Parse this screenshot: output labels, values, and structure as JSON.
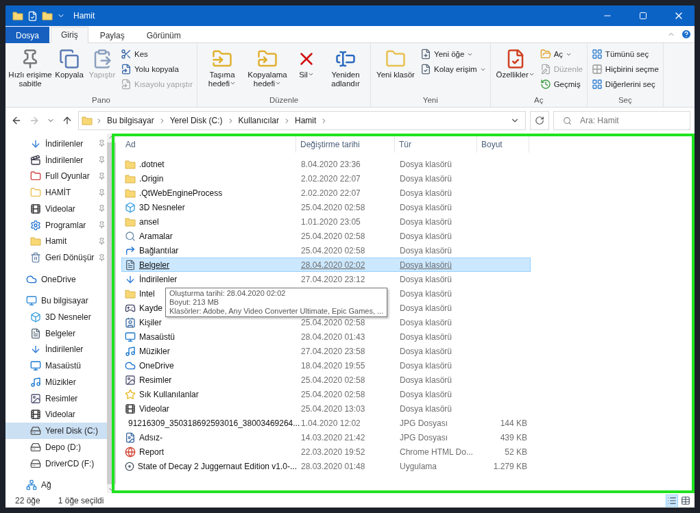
{
  "window": {
    "title": "Hamit"
  },
  "ribbon_tabs": [
    {
      "label": "Dosya",
      "kind": "file",
      "selected": false
    },
    {
      "label": "Giriş",
      "kind": "tab",
      "selected": true
    },
    {
      "label": "Paylaş",
      "kind": "tab",
      "selected": false
    },
    {
      "label": "Görünüm",
      "kind": "tab",
      "selected": false
    }
  ],
  "ribbon_groups": [
    {
      "label": "Pano",
      "items": [
        {
          "kind": "large",
          "label": "Hızlı erişime sabitle",
          "disabled": false,
          "dropdown": false
        },
        {
          "kind": "large",
          "label": "Kopyala",
          "disabled": false,
          "dropdown": false
        },
        {
          "kind": "large",
          "label": "Yapıştır",
          "disabled": true,
          "dropdown": false
        },
        {
          "kind": "small",
          "label": "Kes",
          "disabled": false,
          "dropdown": false
        },
        {
          "kind": "small",
          "label": "Yolu kopyala",
          "disabled": false,
          "dropdown": false
        },
        {
          "kind": "small",
          "label": "Kısayolu yapıştır",
          "disabled": true,
          "dropdown": false
        }
      ]
    },
    {
      "label": "Düzenle",
      "items": [
        {
          "kind": "large",
          "label": "Taşıma hedefi",
          "disabled": false,
          "dropdown": true
        },
        {
          "kind": "large",
          "label": "Kopyalama hedefi",
          "disabled": false,
          "dropdown": true
        },
        {
          "kind": "large",
          "label": "Sil",
          "disabled": false,
          "dropdown": true
        },
        {
          "kind": "large",
          "label": "Yeniden adlandır",
          "disabled": false,
          "dropdown": false
        }
      ]
    },
    {
      "label": "Yeni",
      "items": [
        {
          "kind": "large",
          "label": "Yeni klasör",
          "disabled": false,
          "dropdown": false
        },
        {
          "kind": "small",
          "label": "Yeni öğe",
          "disabled": false,
          "dropdown": true
        },
        {
          "kind": "small",
          "label": "Kolay erişim",
          "disabled": false,
          "dropdown": true
        }
      ]
    },
    {
      "label": "Aç",
      "items": [
        {
          "kind": "large",
          "label": "Özellikler",
          "disabled": false,
          "dropdown": true
        },
        {
          "kind": "small",
          "label": "Aç",
          "disabled": false,
          "dropdown": true
        },
        {
          "kind": "small",
          "label": "Düzenle",
          "disabled": true,
          "dropdown": false
        },
        {
          "kind": "small",
          "label": "Geçmiş",
          "disabled": false,
          "dropdown": false
        }
      ]
    },
    {
      "label": "Seç",
      "items": [
        {
          "kind": "small",
          "label": "Tümünü seç",
          "disabled": false,
          "dropdown": false
        },
        {
          "kind": "small",
          "label": "Hiçbirini seçme",
          "disabled": false,
          "dropdown": false
        },
        {
          "kind": "small",
          "label": "Diğerlerini seç",
          "disabled": false,
          "dropdown": false
        }
      ]
    }
  ],
  "address": {
    "crumbs": [
      "Bu bilgisayar",
      "Yerel Disk (C:)",
      "Kullanıcılar",
      "Hamit"
    ],
    "search_placeholder": "Ara: Hamit"
  },
  "nav": {
    "quick_access": [
      {
        "label": "İndirilenler",
        "pinned": true,
        "selected": false
      },
      {
        "label": "İndirilenler",
        "pinned": true,
        "selected": false
      },
      {
        "label": "Full Oyunlar",
        "pinned": true,
        "selected": false
      },
      {
        "label": "HAMİT",
        "pinned": true,
        "selected": false
      },
      {
        "label": "Videolar",
        "pinned": true,
        "selected": false
      },
      {
        "label": "Programlar",
        "pinned": true,
        "selected": false
      },
      {
        "label": "Hamit",
        "pinned": true,
        "selected": false
      },
      {
        "label": "Geri Dönüşür",
        "pinned": true,
        "selected": false
      }
    ],
    "tree": [
      {
        "label": "OneDrive",
        "selected": false
      },
      {
        "label": "Bu bilgisayar",
        "selected": false,
        "children": [
          {
            "label": "3D Nesneler",
            "selected": false
          },
          {
            "label": "Belgeler",
            "selected": false
          },
          {
            "label": "İndirilenler",
            "selected": false
          },
          {
            "label": "Masaüstü",
            "selected": false
          },
          {
            "label": "Müzikler",
            "selected": false
          },
          {
            "label": "Resimler",
            "selected": false
          },
          {
            "label": "Videolar",
            "selected": false
          },
          {
            "label": "Yerel Disk (C:)",
            "selected": true
          },
          {
            "label": "Depo (D:)",
            "selected": false
          },
          {
            "label": "DriverCD (F:)",
            "selected": false
          }
        ]
      },
      {
        "label": "Ağ",
        "selected": false
      }
    ]
  },
  "files": {
    "columns": [
      "Ad",
      "Değiştirme tarihi",
      "Tür",
      "Boyut"
    ],
    "rows": [
      {
        "name": ".dotnet",
        "date": "8.04.2020 23:36",
        "type": "Dosya klasörü",
        "selected": false
      },
      {
        "name": ".Origin",
        "date": "2.02.2020 22:07",
        "type": "Dosya klasörü",
        "selected": false
      },
      {
        "name": ".QtWebEngineProcess",
        "date": "2.02.2020 22:07",
        "type": "Dosya klasörü",
        "selected": false
      },
      {
        "name": "3D Nesneler",
        "date": "25.04.2020 02:58",
        "type": "Dosya klasörü",
        "selected": false
      },
      {
        "name": "ansel",
        "date": "1.01.2020 23:05",
        "type": "Dosya klasörü",
        "selected": false
      },
      {
        "name": "Aramalar",
        "date": "25.04.2020 02:58",
        "type": "Dosya klasörü",
        "selected": false
      },
      {
        "name": "Bağlantılar",
        "date": "25.04.2020 02:58",
        "type": "Dosya klasörü",
        "selected": false
      },
      {
        "name": "Belgeler",
        "date": "28.04.2020 02:02",
        "type": "Dosya klasörü",
        "selected": true
      },
      {
        "name": "İndirilenler",
        "date": "27.04.2020 23:12",
        "type": "Dosya klasörü",
        "selected": false
      },
      {
        "name": "Intel",
        "type": "Dosya klasörü",
        "selected": false
      },
      {
        "name": "Kayde",
        "type": "Dosya klasörü",
        "selected": false
      },
      {
        "name": "Kişiler",
        "date": "25.04.2020 02:58",
        "type": "Dosya klasörü",
        "selected": false
      },
      {
        "name": "Masaüstü",
        "date": "28.04.2020 01:43",
        "type": "Dosya klasörü",
        "selected": false
      },
      {
        "name": "Müzikler",
        "date": "27.04.2020 23:58",
        "type": "Dosya klasörü",
        "selected": false
      },
      {
        "name": "OneDrive",
        "date": "18.04.2020 19:55",
        "type": "Dosya klasörü",
        "selected": false
      },
      {
        "name": "Resimler",
        "date": "25.04.2020 02:58",
        "type": "Dosya klasörü",
        "selected": false
      },
      {
        "name": "Sık Kullanılanlar",
        "date": "25.04.2020 02:58",
        "type": "Dosya klasörü",
        "selected": false
      },
      {
        "name": "Videolar",
        "date": "25.04.2020 13:03",
        "type": "Dosya klasörü",
        "selected": false
      },
      {
        "name": "91216309_350318692593016_38003469264...",
        "date": "1.04.2020 12:02",
        "type": "JPG Dosyası",
        "size": "144 KB",
        "selected": false
      },
      {
        "name": "Adsız-",
        "date": "14.03.2020 21:42",
        "type": "JPG Dosyası",
        "size": "439 KB",
        "selected": false
      },
      {
        "name": "Report",
        "date": "22.03.2020 19:52",
        "type": "Chrome HTML Do...",
        "size": "52 KB",
        "selected": false
      },
      {
        "name": "State of Decay 2 Juggernaut Edition v1.0-...",
        "date": "28.03.2020 01:48",
        "type": "Uygulama",
        "size": "1.279 KB",
        "selected": false
      }
    ],
    "tooltip": [
      "Oluşturma tarihi: 28.04.2020 02:02",
      "Boyut: 213 MB",
      "Klasörler: Adobe, Any Video Converter Ultimate, Epic Games, ..."
    ]
  },
  "status_bar": {
    "count": "22 öğe",
    "selection": "1 öğe seçildi"
  }
}
